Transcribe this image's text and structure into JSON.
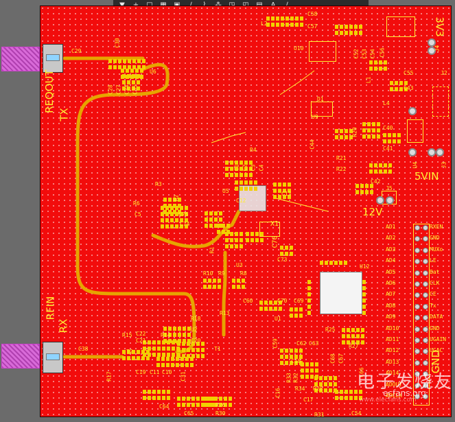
{
  "toolbar": {
    "tools": [
      "filter-tool",
      "add-tool",
      "select-rect-tool",
      "component-tool",
      "chip-tool",
      "route-tool",
      "pad-tool",
      "via-tool",
      "line-tool",
      "text-tool",
      "dimension-tool"
    ],
    "glyphs": [
      "▼",
      "+",
      "□",
      "▦",
      "▣",
      "∕",
      "⌇",
      "⁂",
      "◳",
      "◰",
      "▤",
      "A",
      "∕"
    ]
  },
  "board": {
    "bg_color": "#f20c0c",
    "silk_color": "#ffee33",
    "labels": {
      "reqout": "REQOUT",
      "tx": "TX",
      "rfin": "RFIN",
      "rx": "RX",
      "v33": "3V3",
      "v5": "5VIN",
      "v12": "12V",
      "gnd": "GND"
    },
    "header_pins": [
      "RXEN",
      "GND",
      "MUXo",
      "LE",
      "Bat",
      "CLK",
      "CE",
      "Tx",
      "DATA",
      "GND",
      "UGAIN",
      "UGAC"
    ],
    "adc_pins": [
      "AD1",
      "AD2",
      "AD3",
      "AD4",
      "AD5",
      "AD6",
      "AD7",
      "AD8",
      "AD9",
      "AD10",
      "AD11",
      "AD12",
      "AD13",
      "AD14",
      "ADOUT",
      "ADCLK"
    ],
    "designators": {
      "c29": "C29",
      "c30": "C30",
      "u6": "U6",
      "c28": "C28",
      "c27": "C27",
      "c34": "C34",
      "c35": "C35",
      "c36": "C36",
      "c37": "C37",
      "l2": "L2",
      "c57": "C57",
      "c58": "C58",
      "u10": "U10",
      "c55": "C55",
      "c56": "C56",
      "c52": "C52",
      "c53": "C53",
      "c54": "C54",
      "l1": "L1",
      "c43": "C43",
      "j2": "J2",
      "j4": "J4",
      "j1": "J1",
      "d1": "D1",
      "u9": "U9",
      "l4": "L4",
      "u4": "U4",
      "c40": "C40",
      "c41": "C41",
      "c44": "C44",
      "c42": "C42",
      "r20": "R20",
      "r21": "R21",
      "r22": "R22",
      "j5": "J5",
      "j3": "J3",
      "r3": "R3",
      "c1": "C1",
      "c2": "C2",
      "c3": "C3",
      "c4": "C4",
      "r4": "R4",
      "r5": "R5",
      "r6": "R6",
      "r7": "R7",
      "c5": "C5",
      "c6": "C6",
      "c7": "C7",
      "c8": "C8",
      "u5": "U5",
      "c12": "C12",
      "c13": "C13",
      "c75": "C75",
      "c74": "C74",
      "x1": "X1",
      "c76": "C76",
      "r2": "R2",
      "r1": "R1",
      "r9": "R9",
      "r10": "R10",
      "r8": "R8",
      "u3": "U3",
      "c60": "C60",
      "c70": "C70",
      "c69": "C69",
      "c73": "C73",
      "r25": "R25",
      "r24": "R24",
      "u1": "U1",
      "u12": "U12",
      "c59": "C59",
      "c62": "C62",
      "c63": "C63",
      "r18": "R18",
      "r13": "R13",
      "u2": "U2",
      "r14": "R14",
      "r15": "R15",
      "r16": "R16",
      "r17": "R17",
      "c38": "C38",
      "c22": "C22",
      "c21": "C21",
      "c20": "C20",
      "t2": "T2",
      "t1": "T1",
      "c19": "C19",
      "c11": "C11",
      "c10": "C10",
      "c31": "C31",
      "c64": "C64",
      "c65": "C65",
      "r26": "R26",
      "r30": "R30",
      "r27": "R27",
      "r29": "R29",
      "c18": "C18",
      "r32": "R32",
      "r33": "R33",
      "r34": "R34",
      "r28": "R28",
      "c17": "C17",
      "c16": "C16",
      "r31": "R31",
      "c54b": "C54",
      "c68": "C68",
      "c67": "C67",
      "c66": "C66"
    }
  },
  "watermark": {
    "main": "电子发烧友",
    "url": "www.elecfans.com",
    "url2": "ecfans.org"
  }
}
